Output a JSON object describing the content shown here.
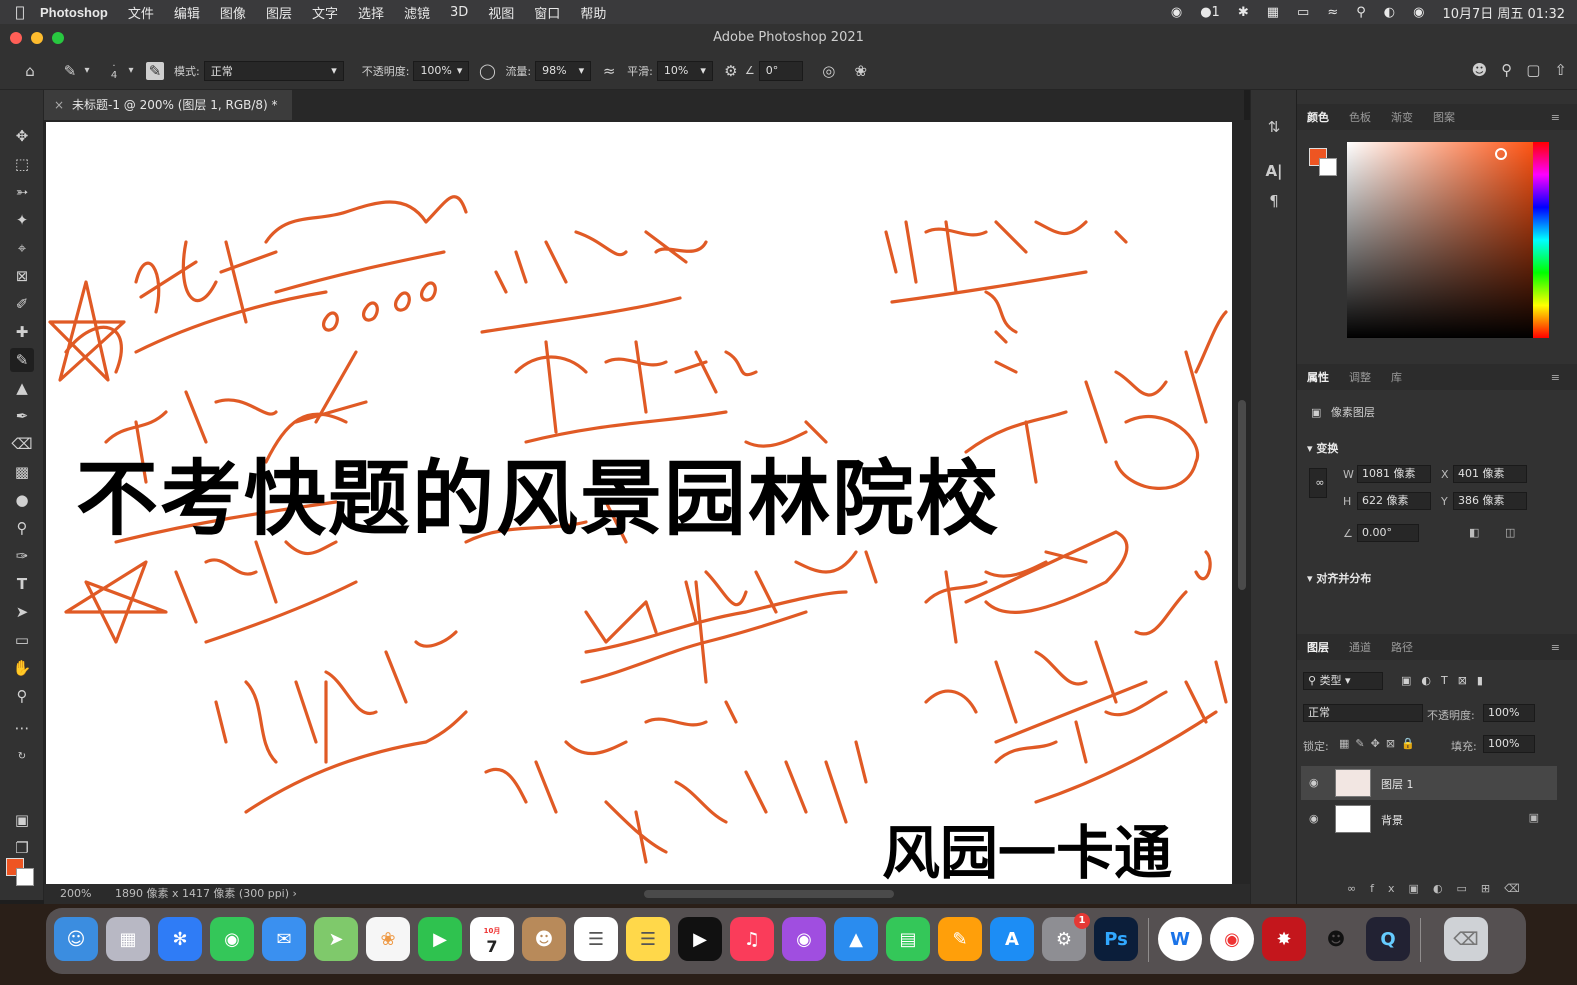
{
  "menubar": {
    "app_name": "Photoshop",
    "items": [
      "文件",
      "编辑",
      "图像",
      "图层",
      "文字",
      "选择",
      "滤镜",
      "3D",
      "视图",
      "窗口",
      "帮助"
    ],
    "notification_count": "1",
    "datetime": "10月7日 周五 01:32"
  },
  "window": {
    "title": "Adobe Photoshop 2021"
  },
  "options": {
    "brush_size": "4",
    "mode_label": "模式:",
    "mode_value": "正常",
    "opacity_label": "不透明度:",
    "opacity_value": "100%",
    "flow_label": "流量:",
    "flow_value": "98%",
    "smoothing_label": "平滑:",
    "smoothing_value": "10%",
    "angle_value": "0°"
  },
  "document": {
    "tab_title": "未标题-1 @ 200% (图层 1, RGB/8) *",
    "headline": "不考快题的风景园林院校",
    "watermark": "风园一卡通"
  },
  "status": {
    "zoom": "200%",
    "doc_info": "1890 像素 x 1417 像素 (300 ppi)"
  },
  "color_panel": {
    "tabs": [
      "颜色",
      "色板",
      "渐变",
      "图案"
    ],
    "foreground": "#ee5522",
    "background": "#ffffff"
  },
  "properties_panel": {
    "tabs": [
      "属性",
      "调整",
      "库"
    ],
    "layer_type": "像素图层",
    "transform_label": "变换",
    "w_label": "W",
    "w_value": "1081 像素",
    "h_label": "H",
    "h_value": "622 像素",
    "x_label": "X",
    "x_value": "401 像素",
    "y_label": "Y",
    "y_value": "386 像素",
    "angle_value": "0.00°",
    "align_label": "对齐并分布"
  },
  "layers_panel": {
    "tabs": [
      "图层",
      "通道",
      "路径"
    ],
    "filter_kind": "类型",
    "blend_mode": "正常",
    "opacity_label": "不透明度:",
    "opacity_value": "100%",
    "lock_label": "锁定:",
    "fill_label": "填充:",
    "fill_value": "100%",
    "layers": [
      {
        "name": "图层 1",
        "selected": true
      },
      {
        "name": "背景",
        "selected": false,
        "locked": true
      }
    ]
  },
  "dock": {
    "calendar_month": "10月",
    "calendar_day": "7",
    "settings_badge": "1",
    "photoshop_label": "Ps",
    "wps_label": "W"
  }
}
